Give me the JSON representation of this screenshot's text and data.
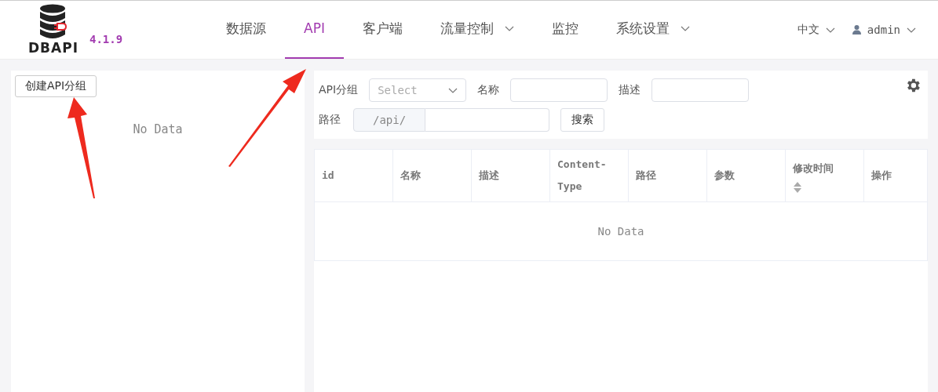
{
  "logo": {
    "name": "DBAPI",
    "version": "4.1.9"
  },
  "nav": [
    {
      "label": "数据源",
      "selected": false,
      "dropdown": false
    },
    {
      "label": "API",
      "selected": true,
      "dropdown": false
    },
    {
      "label": "客户端",
      "selected": false,
      "dropdown": false
    },
    {
      "label": "流量控制",
      "selected": false,
      "dropdown": true
    },
    {
      "label": "监控",
      "selected": false,
      "dropdown": false
    },
    {
      "label": "系统设置",
      "selected": false,
      "dropdown": true
    }
  ],
  "language": {
    "label": "中文"
  },
  "user": {
    "label": "admin"
  },
  "sidebar": {
    "create_button": "创建API分组",
    "empty_text": "No Data"
  },
  "filters": {
    "group_label": "API分组",
    "group_placeholder": "Select",
    "name_label": "名称",
    "desc_label": "描述",
    "path_label": "路径",
    "path_prefix": "/api/",
    "search_button": "搜索"
  },
  "table": {
    "columns": [
      {
        "label": "id",
        "sortable": false
      },
      {
        "label": "名称",
        "sortable": false
      },
      {
        "label": "描述",
        "sortable": false
      },
      {
        "label": "Content-Type",
        "sortable": false
      },
      {
        "label": "路径",
        "sortable": false
      },
      {
        "label": "参数",
        "sortable": false
      },
      {
        "label": "修改时间",
        "sortable": true
      },
      {
        "label": "操作",
        "sortable": false
      }
    ],
    "empty_text": "No Data"
  }
}
